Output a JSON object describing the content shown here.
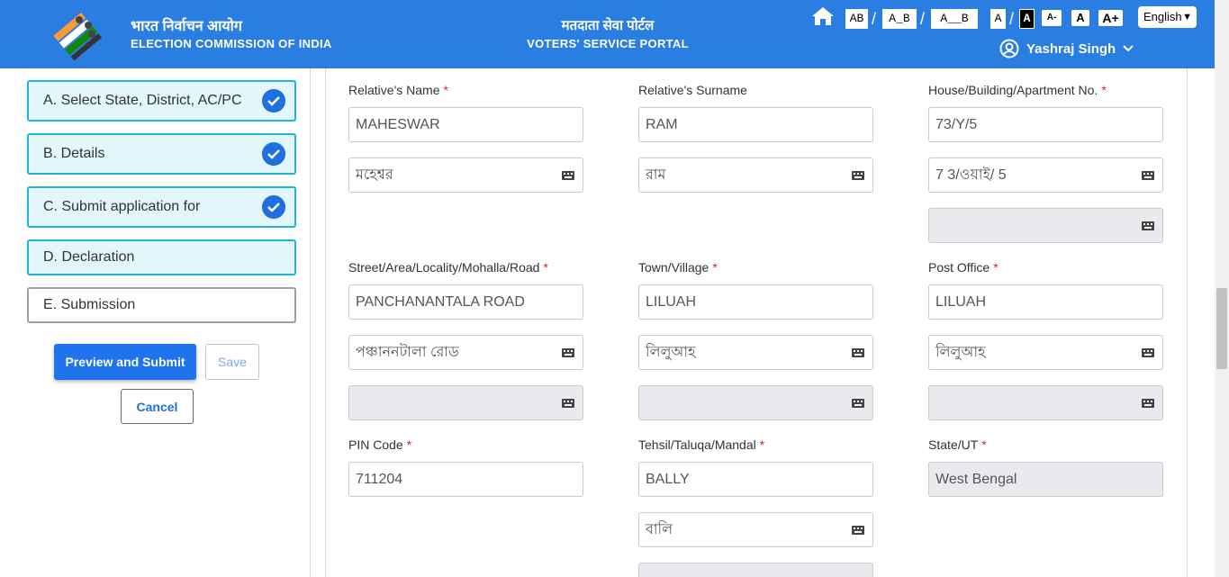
{
  "header": {
    "eci_hindi": "भारत निर्वाचन आयोग",
    "eci_english": "ELECTION COMMISSION OF INDIA",
    "portal_hindi": "मतदाता सेवा पोर्टल",
    "portal_english": "VOTERS' SERVICE PORTAL",
    "spacing_tools": [
      "AB",
      "A_B",
      "A__B"
    ],
    "contrast_tools": [
      "A",
      "A"
    ],
    "font_tools": [
      "A-",
      "A",
      "A+"
    ],
    "language": "English",
    "user_name": "Yashraj Singh"
  },
  "sidebar": {
    "steps": [
      {
        "label": "A. Select State, District, AC/PC",
        "done": true
      },
      {
        "label": "B. Details",
        "done": true
      },
      {
        "label": "C. Submit application for",
        "done": true
      },
      {
        "label": "D. Declaration",
        "done": false
      },
      {
        "label": "E. Submission",
        "done": false
      }
    ],
    "preview_submit_label": "Preview and Submit",
    "save_label": "Save",
    "cancel_label": "Cancel"
  },
  "form": {
    "relative_name": {
      "label": "Relative's Name",
      "value": "MAHESWAR",
      "regional": "মহেশ্বর"
    },
    "relative_surname": {
      "label": "Relative's Surname",
      "value": "RAM",
      "regional": "রাম"
    },
    "house_no": {
      "label": "House/Building/Apartment No.",
      "value": "73/Y/5",
      "regional": "7 3/ওয়াই/ 5"
    },
    "street": {
      "label": "Street/Area/Locality/Mohalla/Road",
      "value": "PANCHANANTALA ROAD",
      "regional": "পঞ্চাননটালা রোড"
    },
    "town": {
      "label": "Town/Village",
      "value": "LILUAH",
      "regional": "লিলুআহ"
    },
    "post_office": {
      "label": "Post Office",
      "value": "LILUAH",
      "regional": "লিলুআহ"
    },
    "pin": {
      "label": "PIN Code",
      "value": "711204"
    },
    "tehsil": {
      "label": "Tehsil/Taluqa/Mandal",
      "value": "BALLY",
      "regional": "বালি"
    },
    "state": {
      "label": "State/UT",
      "value": "West Bengal"
    },
    "required_marker": "*"
  },
  "colors": {
    "header_bg": "#2a7de1",
    "step_border": "#1fb4d8",
    "step_bg": "#e2f6fb",
    "check": "#1f6fe0",
    "required": "#e0201f"
  }
}
